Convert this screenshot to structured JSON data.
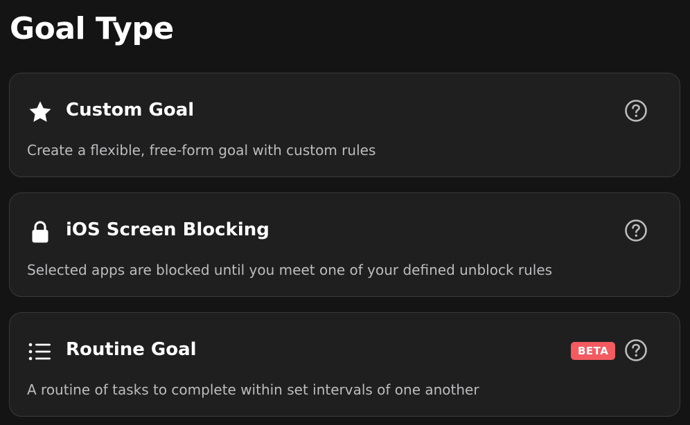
{
  "page": {
    "title": "Goal Type"
  },
  "colors": {
    "background": "#141414",
    "card_background": "#1f1f20",
    "card_border": "#3a3a3c",
    "description_text": "#bdbdbf",
    "beta_badge": "#f35b61"
  },
  "goal_types": [
    {
      "icon": "star-icon",
      "title": "Custom Goal",
      "description": "Create a flexible, free-form goal with custom rules"
    },
    {
      "icon": "lock-icon",
      "title": "iOS Screen Blocking",
      "description": "Selected apps are blocked until you meet one of your defined unblock rules"
    },
    {
      "icon": "list-icon",
      "title": "Routine Goal",
      "badge": "BETA",
      "description": "A routine of tasks to complete within set intervals of one another"
    }
  ]
}
